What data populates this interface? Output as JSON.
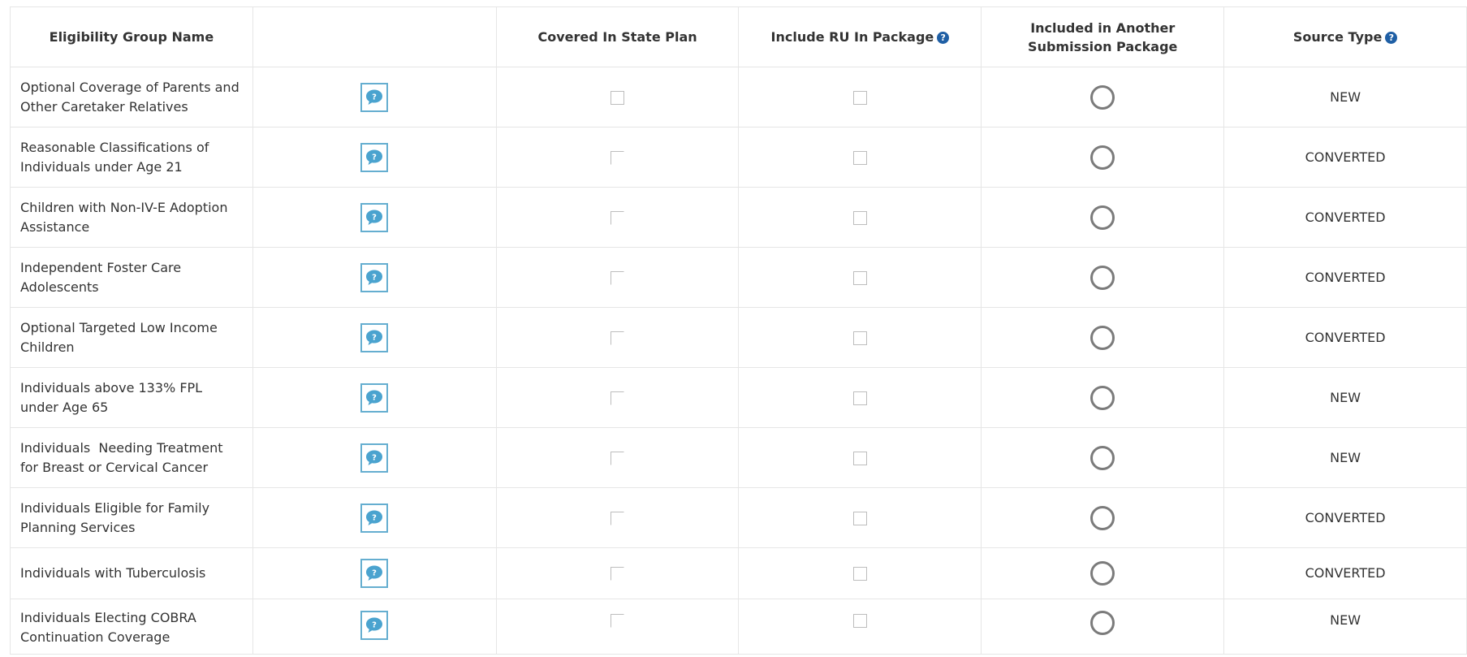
{
  "headers": {
    "name": "Eligibility Group Name",
    "info": "",
    "covered": "Covered In State Plan",
    "include_ru": "Include RU In Package",
    "included_other": "Included in Another Submission Package",
    "source_type": "Source Type"
  },
  "help_icon_glyph": "?",
  "colors": {
    "icon_border": "#65aed0",
    "help_badge": "#1f5fa5"
  },
  "rows": [
    {
      "name": "Optional Coverage of Parents and Other Caretaker Relatives",
      "source": "NEW"
    },
    {
      "name": "Reasonable Classifications of Individuals under Age 21",
      "source": "CONVERTED"
    },
    {
      "name": "Children with Non-IV-E Adoption Assistance",
      "source": "CONVERTED"
    },
    {
      "name": "Independent Foster Care Adolescents",
      "source": "CONVERTED"
    },
    {
      "name": "Optional Targeted Low Income Children",
      "source": "CONVERTED"
    },
    {
      "name": "Individuals above 133% FPL under Age 65",
      "source": "NEW"
    },
    {
      "name": "Individuals  Needing Treatment for Breast or Cervical Cancer",
      "source": "NEW"
    },
    {
      "name": "Individuals Eligible for Family Planning Services",
      "source": "CONVERTED"
    },
    {
      "name": "Individuals with Tuberculosis",
      "source": "CONVERTED"
    },
    {
      "name": "Individuals Electing COBRA Continuation Coverage",
      "source": "NEW"
    }
  ]
}
